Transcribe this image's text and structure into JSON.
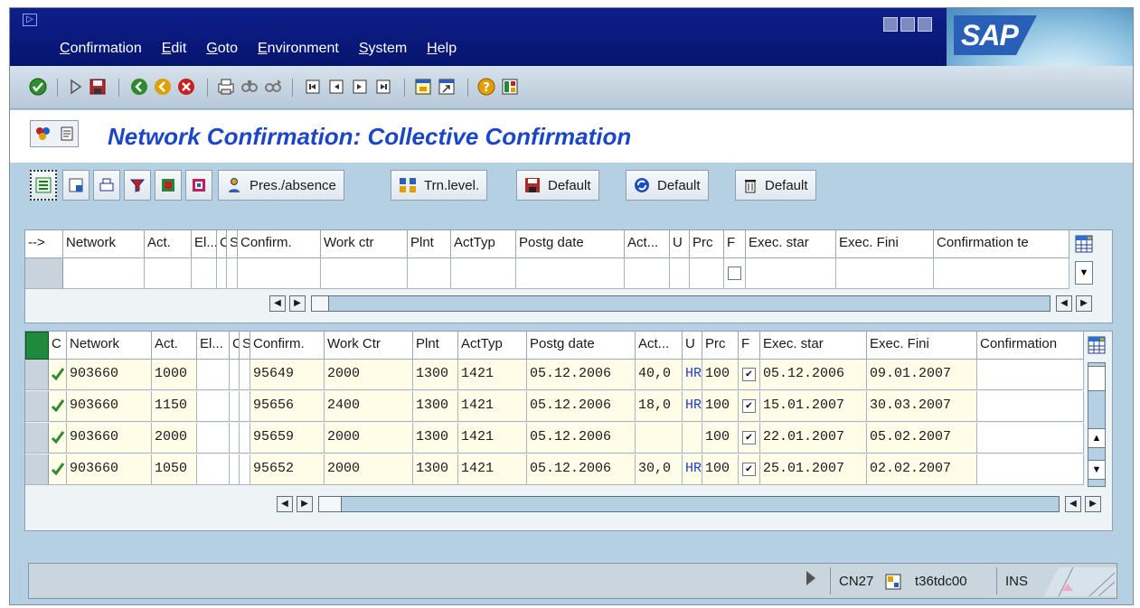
{
  "window": {
    "menu": [
      "Confirmation",
      "Edit",
      "Goto",
      "Environment",
      "System",
      "Help"
    ],
    "brand": "SAP",
    "title": "Network Confirmation: Collective Confirmation"
  },
  "toolbar": {
    "icons": [
      "enter-icon",
      "command-field-icon",
      "save-icon",
      "back-icon",
      "exit-icon",
      "cancel-icon",
      "print-icon",
      "find-icon",
      "find-next-icon",
      "first-page-icon",
      "previous-page-icon",
      "next-page-icon",
      "last-page-icon",
      "create-session-icon",
      "create-shortcut-icon",
      "help-icon",
      "layout-icon"
    ]
  },
  "app_toolbar": {
    "pres_absence": "Pres./absence",
    "trm_level": "Trn.level.",
    "default_1": "Default",
    "default_2": "Default",
    "default_3": "Default"
  },
  "entry_table": {
    "headers": [
      "-->",
      "Network",
      "Act.",
      "El...",
      "C",
      "S",
      "Confirm.",
      "Work ctr",
      "Plnt",
      "ActTyp",
      "Postg date",
      "Act...",
      "U",
      "Prc",
      "F",
      "Exec. star",
      "Exec. Fini",
      "Confirmation te"
    ]
  },
  "conf_table": {
    "headers": [
      "C",
      "Network",
      "Act.",
      "El...",
      "C",
      "S",
      "Confirm.",
      "Work Ctr",
      "Plnt",
      "ActTyp",
      "Postg date",
      "Act...",
      "U",
      "Prc",
      "F",
      "Exec. star",
      "Exec. Fini",
      "Confirmation"
    ],
    "rows": [
      {
        "network": "903660",
        "act": "1000",
        "confirm": "95649",
        "work_ctr": "2000",
        "plnt": "1300",
        "acttyp": "1421",
        "postg_date": "05.12.2006",
        "actwork": "40,0",
        "unit": "HR",
        "prc": "100",
        "final": true,
        "exec_start": "05.12.2006",
        "exec_finish": "09.01.2007"
      },
      {
        "network": "903660",
        "act": "1150",
        "confirm": "95656",
        "work_ctr": "2400",
        "plnt": "1300",
        "acttyp": "1421",
        "postg_date": "05.12.2006",
        "actwork": "18,0",
        "unit": "HR",
        "prc": "100",
        "final": true,
        "exec_start": "15.01.2007",
        "exec_finish": "30.03.2007"
      },
      {
        "network": "903660",
        "act": "2000",
        "confirm": "95659",
        "work_ctr": "2000",
        "plnt": "1300",
        "acttyp": "1421",
        "postg_date": "05.12.2006",
        "actwork": "",
        "unit": "",
        "prc": "100",
        "final": true,
        "exec_start": "22.01.2007",
        "exec_finish": "05.02.2007"
      },
      {
        "network": "903660",
        "act": "1050",
        "confirm": "95652",
        "work_ctr": "2000",
        "plnt": "1300",
        "acttyp": "1421",
        "postg_date": "05.12.2006",
        "actwork": "30,0",
        "unit": "HR",
        "prc": "100",
        "final": true,
        "exec_start": "25.01.2007",
        "exec_finish": "02.02.2007"
      }
    ]
  },
  "status": {
    "transaction": "CN27",
    "server": "t36tdc00",
    "mode": "INS"
  }
}
